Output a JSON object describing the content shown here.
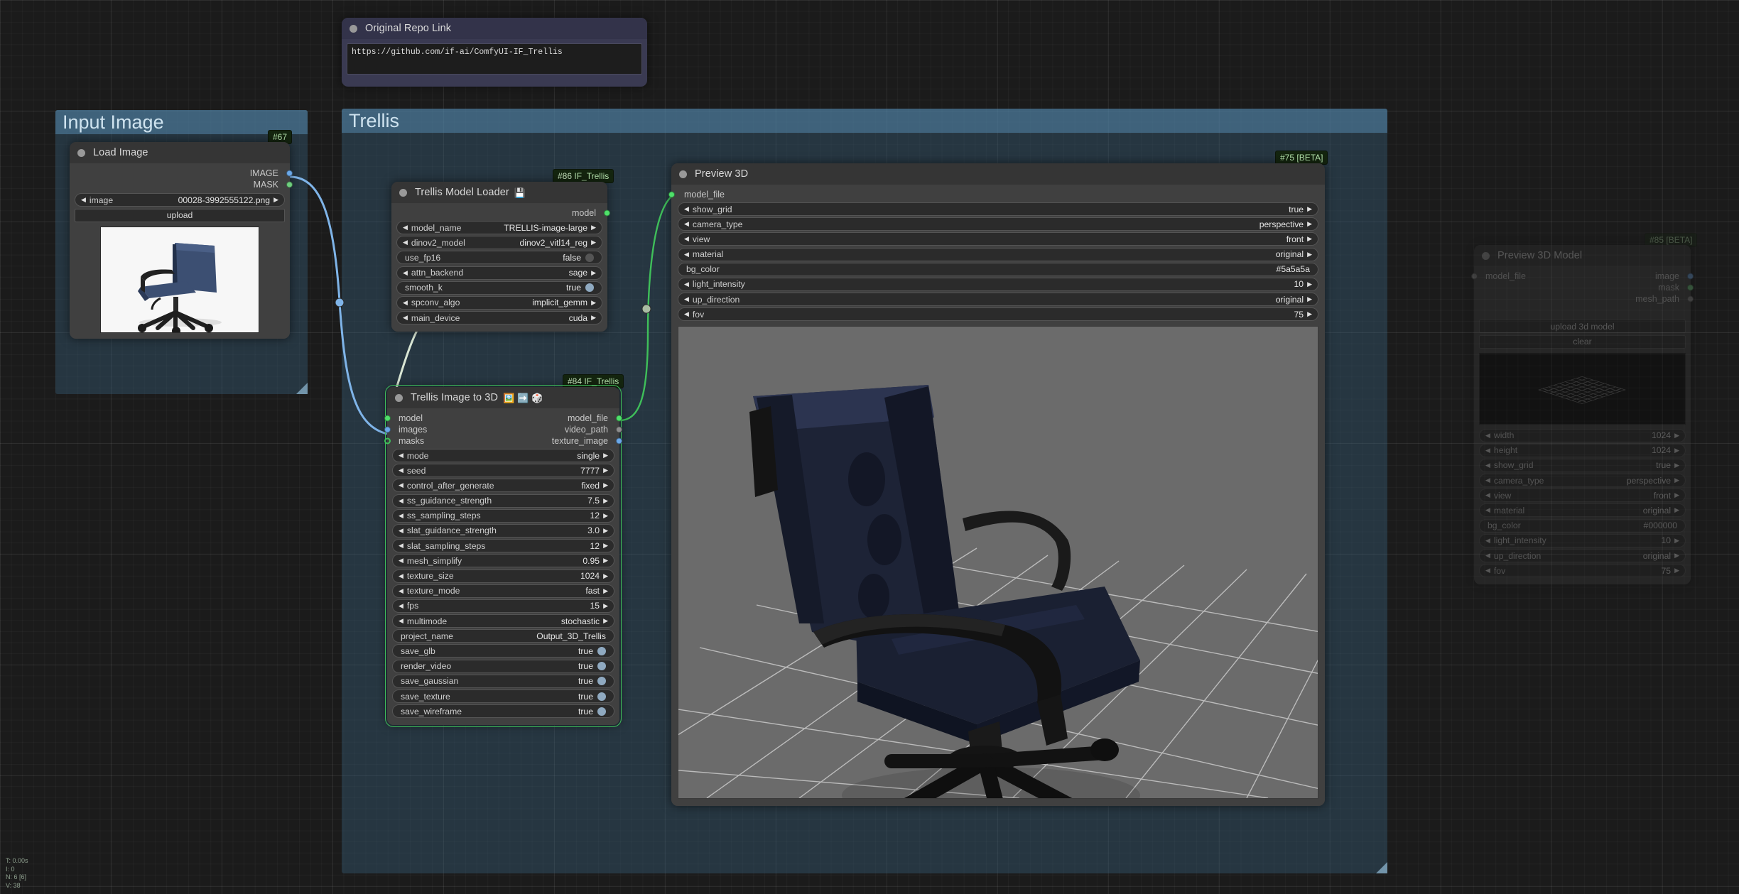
{
  "status_overlay": {
    "time": "T: 0.00s",
    "iterations": "I: 0",
    "nodes": "N: 6 [6]",
    "vertices": "V: 38"
  },
  "groups": [
    {
      "name": "input-image-group",
      "title": "Input Image"
    },
    {
      "name": "trellis-group",
      "title": "Trellis"
    }
  ],
  "note_node": {
    "title": "Original Repo Link",
    "text": "https://github.com/if-ai/ComfyUI-IF_Trellis"
  },
  "load_image_node": {
    "badge": "#67",
    "title": "Load Image",
    "outputs": [
      {
        "label": "IMAGE",
        "color": "#6ba8e8"
      },
      {
        "label": "MASK",
        "color": "#6fcf7f"
      }
    ],
    "widgets": [
      {
        "label": "image",
        "value": "00028-3992555122.png",
        "type": "combo"
      }
    ],
    "upload_button": "upload",
    "image_alt": "blue office chair on white background"
  },
  "model_loader_node": {
    "badge_num": "#86",
    "badge_type": "IF_Trellis",
    "title": "Trellis Model Loader",
    "title_icons": [
      "floppy-disk-icon"
    ],
    "outputs": [
      {
        "label": "model",
        "color": "#4fe06a"
      }
    ],
    "widgets": [
      {
        "label": "model_name",
        "value": "TRELLIS-image-large",
        "type": "combo"
      },
      {
        "label": "dinov2_model",
        "value": "dinov2_vitl14_reg",
        "type": "combo"
      },
      {
        "label": "use_fp16",
        "value": "false",
        "type": "toggle-off"
      },
      {
        "label": "attn_backend",
        "value": "sage",
        "type": "combo"
      },
      {
        "label": "smooth_k",
        "value": "true",
        "type": "toggle-on"
      },
      {
        "label": "spconv_algo",
        "value": "implicit_gemm",
        "type": "combo"
      },
      {
        "label": "main_device",
        "value": "cuda",
        "type": "combo"
      }
    ]
  },
  "image_to_3d_node": {
    "badge_num": "#84",
    "badge_type": "IF_Trellis",
    "title": "Trellis Image to 3D",
    "title_icons": [
      "image-icon",
      "blue-arrow-icon",
      "dice-icon"
    ],
    "inputs": [
      {
        "label": "model",
        "color": "#4fe06a"
      },
      {
        "label": "images",
        "color": "#6ba8e8"
      },
      {
        "label": "masks",
        "color": "#4fe06a",
        "hollow": true
      }
    ],
    "outputs": [
      {
        "label": "model_file",
        "color": "#4fe06a"
      },
      {
        "label": "video_path",
        "color": "#8d8d8d"
      },
      {
        "label": "texture_image",
        "color": "#6ba8e8"
      }
    ],
    "widgets": [
      {
        "label": "mode",
        "value": "single",
        "type": "combo"
      },
      {
        "label": "seed",
        "value": "7777",
        "type": "combo"
      },
      {
        "label": "control_after_generate",
        "value": "fixed",
        "type": "combo"
      },
      {
        "label": "ss_guidance_strength",
        "value": "7.5",
        "type": "combo"
      },
      {
        "label": "ss_sampling_steps",
        "value": "12",
        "type": "combo"
      },
      {
        "label": "slat_guidance_strength",
        "value": "3.0",
        "type": "combo"
      },
      {
        "label": "slat_sampling_steps",
        "value": "12",
        "type": "combo"
      },
      {
        "label": "mesh_simplify",
        "value": "0.95",
        "type": "combo"
      },
      {
        "label": "texture_size",
        "value": "1024",
        "type": "combo"
      },
      {
        "label": "texture_mode",
        "value": "fast",
        "type": "combo"
      },
      {
        "label": "fps",
        "value": "15",
        "type": "combo"
      },
      {
        "label": "multimode",
        "value": "stochastic",
        "type": "combo"
      },
      {
        "label": "project_name",
        "value": "Output_3D_Trellis",
        "type": "text"
      },
      {
        "label": "save_glb",
        "value": "true",
        "type": "toggle-on"
      },
      {
        "label": "render_video",
        "value": "true",
        "type": "toggle-on"
      },
      {
        "label": "save_gaussian",
        "value": "true",
        "type": "toggle-on"
      },
      {
        "label": "save_texture",
        "value": "true",
        "type": "toggle-on"
      },
      {
        "label": "save_wireframe",
        "value": "true",
        "type": "toggle-on"
      }
    ]
  },
  "preview_3d_node": {
    "badge": "#75 [BETA]",
    "title": "Preview 3D",
    "inputs": [
      {
        "label": "model_file",
        "color": "#4fe06a"
      }
    ],
    "widgets": [
      {
        "label": "show_grid",
        "value": "true",
        "type": "combo"
      },
      {
        "label": "camera_type",
        "value": "perspective",
        "type": "combo"
      },
      {
        "label": "view",
        "value": "front",
        "type": "combo"
      },
      {
        "label": "material",
        "value": "original",
        "type": "combo"
      },
      {
        "label": "bg_color",
        "value": "#5a5a5a",
        "type": "text"
      },
      {
        "label": "light_intensity",
        "value": "10",
        "type": "combo"
      },
      {
        "label": "up_direction",
        "value": "original",
        "type": "combo"
      },
      {
        "label": "fov",
        "value": "75",
        "type": "combo"
      }
    ],
    "viewport_alt": "3D preview of dark blue office chair on grey grid floor"
  },
  "preview_3d_model_node": {
    "badge": "#85 [BETA]",
    "title": "Preview 3D Model",
    "inputs": [
      {
        "label": "model_file",
        "color": "#8d8d8d"
      }
    ],
    "outputs": [
      {
        "label": "image",
        "color": "#6ba8e8"
      },
      {
        "label": "mask",
        "color": "#6fcf7f"
      },
      {
        "label": "mesh_path",
        "color": "#8d8d8d"
      }
    ],
    "buttons": [
      "upload 3d model",
      "clear"
    ],
    "viewport_alt": "empty black 3D viewport with wireframe ground grid",
    "widgets": [
      {
        "label": "width",
        "value": "1024",
        "type": "combo"
      },
      {
        "label": "height",
        "value": "1024",
        "type": "combo"
      },
      {
        "label": "show_grid",
        "value": "true",
        "type": "combo"
      },
      {
        "label": "camera_type",
        "value": "perspective",
        "type": "combo"
      },
      {
        "label": "view",
        "value": "front",
        "type": "combo"
      },
      {
        "label": "material",
        "value": "original",
        "type": "combo"
      },
      {
        "label": "bg_color",
        "value": "#000000",
        "type": "text"
      },
      {
        "label": "light_intensity",
        "value": "10",
        "type": "combo"
      },
      {
        "label": "up_direction",
        "value": "original",
        "type": "combo"
      },
      {
        "label": "fov",
        "value": "75",
        "type": "combo"
      }
    ]
  },
  "colors": {
    "link_image": "#7fb4e8",
    "link_model": "#d9e6d4",
    "link_modelfile": "#3fbf5a",
    "group_header": "#568cb0",
    "node_body": "#404040"
  }
}
